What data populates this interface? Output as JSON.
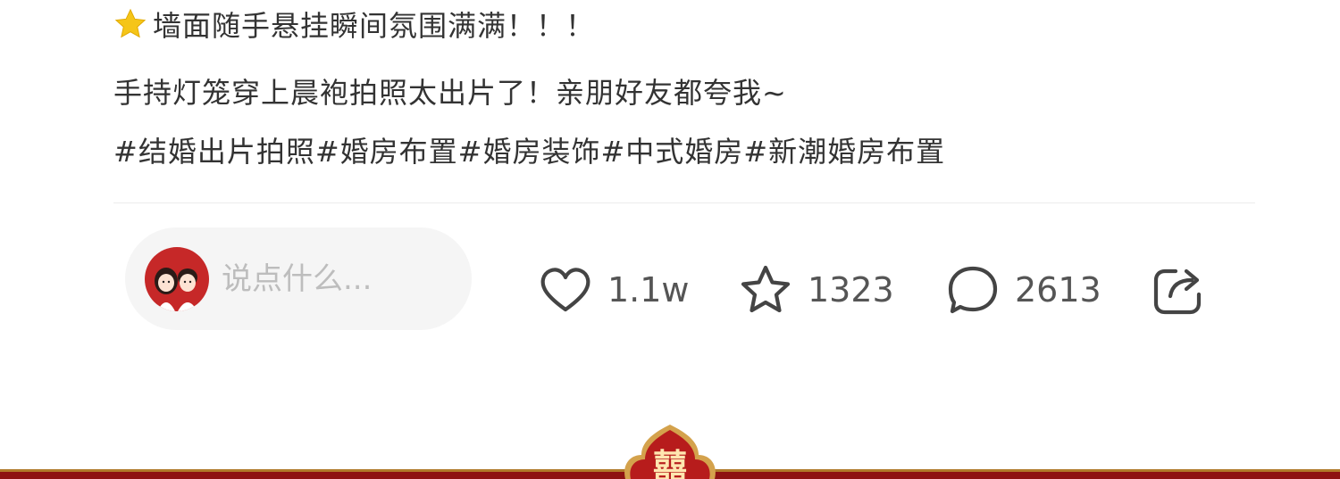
{
  "post": {
    "title_line": "墙面随手悬挂瞬间氛围满满！！！",
    "body_line": "手持灯笼穿上晨袍拍照太出片了！亲朋好友都夸我~",
    "hashtags": "#结婚出片拍照#婚房布置#婚房装饰#中式婚房#新潮婚房布置",
    "title_icon": "star-icon"
  },
  "comment_input": {
    "placeholder": "说点什么...",
    "avatar_icon": "couple-avatar"
  },
  "actions": {
    "like_count": "1.1w",
    "favorite_count": "1323",
    "comment_count": "2613",
    "like_icon": "heart-icon",
    "favorite_icon": "star-outline-icon",
    "comment_icon": "speech-bubble-icon",
    "share_icon": "share-icon"
  },
  "decoration": {
    "badge_text": "囍"
  },
  "colors": {
    "text": "#333333",
    "placeholder": "#bdbdbd",
    "star": "#f5c518",
    "wedding_red": "#b71c1c",
    "gold": "#d4a24c"
  }
}
